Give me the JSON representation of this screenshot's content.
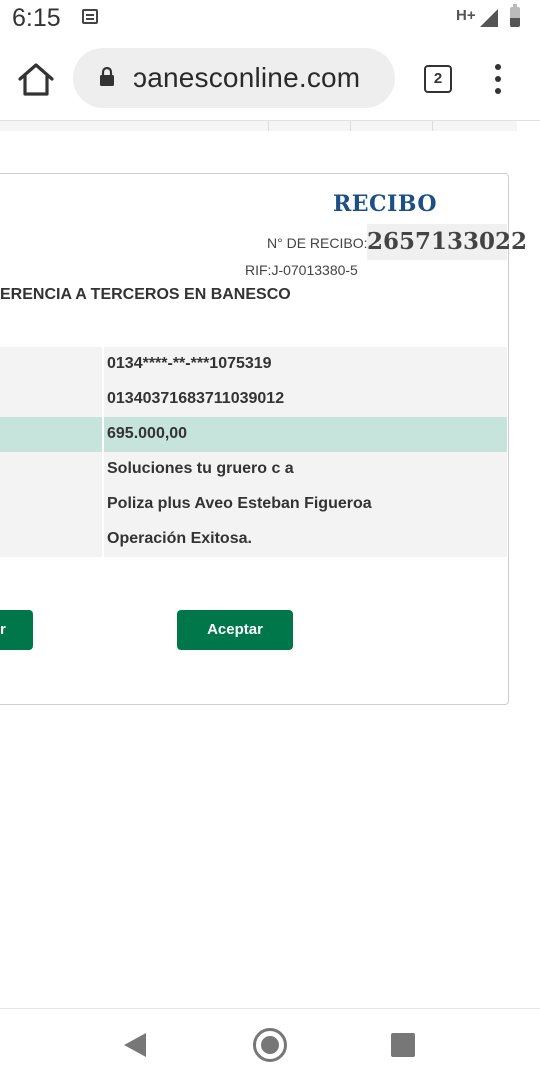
{
  "status_bar": {
    "time": "6:15",
    "network_type": "H+",
    "icons": [
      "notification-icon",
      "signal-icon",
      "battery-icon"
    ]
  },
  "browser": {
    "url": "banesconline.com",
    "url_visible": "ɔanesconline.com",
    "tab_count": "2",
    "icons": [
      "home-icon",
      "lock-icon",
      "tabs-icon",
      "menu-icon"
    ]
  },
  "receipt": {
    "title": "RECIBO",
    "number_label": "N° DE RECIBO:",
    "number": "2657133022",
    "rif": "RIF:J-07013380-5",
    "transfer_title": "ERENCIA A TERCEROS EN BANESCO",
    "rows": [
      {
        "value": "0134****-**-***1075319"
      },
      {
        "value": "01340371683711039012"
      },
      {
        "value": "695.000,00"
      },
      {
        "value": "Soluciones tu gruero c a"
      },
      {
        "value": "Poliza plus Aveo Esteban Figueroa"
      },
      {
        "value": "Operación Exitosa."
      }
    ],
    "left_button_label": "r",
    "accept_button_label": "Aceptar"
  },
  "colors": {
    "title_blue": "#1c4f86",
    "button_green": "#00774b",
    "highlight_row": "#c6e4dc",
    "row_gray": "#f3f3f3"
  },
  "nav_bar": {
    "icons": [
      "back-icon",
      "home-circle-icon",
      "recent-apps-icon"
    ]
  }
}
